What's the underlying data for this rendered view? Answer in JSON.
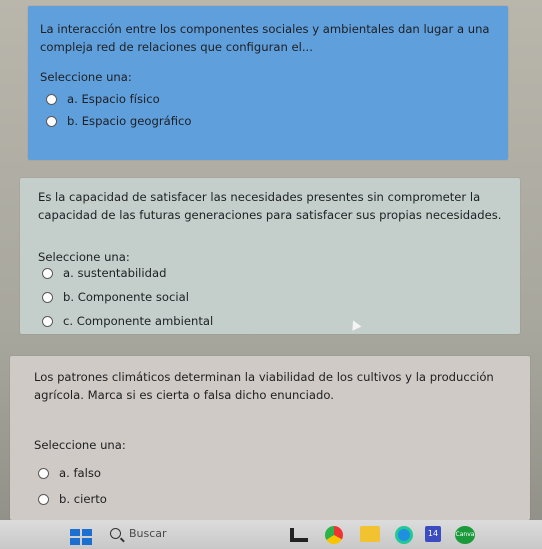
{
  "questions": [
    {
      "text": "La interacción entre los componentes sociales y ambientales dan lugar a una compleja red de relaciones que configuran el...",
      "prompt": "Seleccione una:",
      "options": [
        {
          "label": "a. Espacio físico"
        },
        {
          "label": "b. Espacio geográfico"
        }
      ]
    },
    {
      "text": "Es la capacidad de satisfacer las necesidades presentes sin comprometer la capacidad de las futuras generaciones para satisfacer sus propias necesidades.",
      "prompt": "Seleccione una:",
      "options": [
        {
          "label": "a. sustentabilidad"
        },
        {
          "label": "b. Componente social"
        },
        {
          "label": "c. Componente ambiental"
        }
      ]
    },
    {
      "text": "Los patrones climáticos determinan la viabilidad de los cultivos y la producción agrícola. Marca si es cierta o falsa dicho enunciado.",
      "prompt": "Seleccione una:",
      "options": [
        {
          "label": "a. falso"
        },
        {
          "label": "b. cierto"
        }
      ]
    }
  ],
  "taskbar": {
    "search_label": "Buscar",
    "icons": [
      "start-icon",
      "widgets-icon",
      "chrome-icon",
      "files-icon",
      "edge-icon",
      "store-icon",
      "app-icon"
    ],
    "store_label": "14",
    "app_label": "Canva"
  },
  "colors": {
    "q1_bg": "#5f9fdc",
    "q2_bg": "#c4cfcc",
    "q3_bg": "#cfcac5"
  }
}
